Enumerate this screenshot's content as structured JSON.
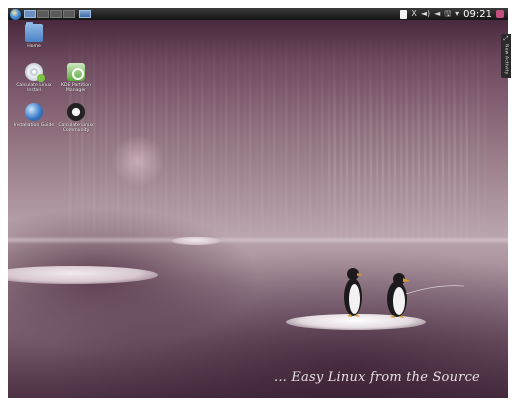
{
  "panel": {
    "clock": "09:21",
    "tray_icons": [
      "clipboard-icon",
      "x-close-icon",
      "volume-icon",
      "speaker-icon",
      "network-icon",
      "chevron-down-icon"
    ],
    "tray_glyphs": {
      "x": "X",
      "volume": "◄)",
      "speaker": "◄",
      "network": "🖫",
      "chevron": "▾"
    }
  },
  "desktop_icons": [
    {
      "label": "Home",
      "icon": "home-folder-icon"
    },
    {
      "label": "Calculate Linux Install",
      "icon": "install-disc-icon"
    },
    {
      "label": "KDE Partition Manager",
      "icon": "partition-manager-icon"
    },
    {
      "label": "Installation Guide",
      "icon": "globe-icon"
    },
    {
      "label": "Calculate Linux Community",
      "icon": "megaphone-icon"
    }
  ],
  "widget": {
    "label": "New Activity",
    "icon": "activity-icon",
    "glyph": "⤢"
  },
  "wallpaper": {
    "slogan": "... Easy Linux from the Source",
    "colors": {
      "sky_top": "#3e1f33",
      "mid": "#b9a4ad",
      "bottom": "#4c3043"
    }
  }
}
